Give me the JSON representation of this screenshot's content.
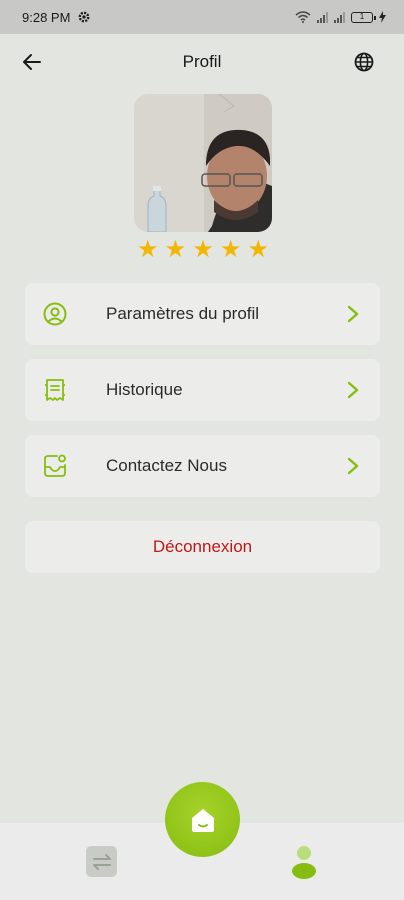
{
  "status_bar": {
    "time": "9:28 PM",
    "battery": "1"
  },
  "header": {
    "title": "Profil"
  },
  "profile": {
    "rating": 5,
    "stars": [
      "★",
      "★",
      "★",
      "★",
      "★"
    ]
  },
  "menu": {
    "items": [
      {
        "label": "Paramètres du profil",
        "icon": "user-circle-icon"
      },
      {
        "label": "Historique",
        "icon": "receipt-icon"
      },
      {
        "label": "Contactez Nous",
        "icon": "message-box-icon"
      }
    ]
  },
  "logout": {
    "label": "Déconnexion"
  },
  "colors": {
    "accent": "#86bd10",
    "star": "#f2b705",
    "danger": "#c01818",
    "background": "#e3e5e0"
  },
  "bottom_nav": {
    "items": [
      "swap-icon",
      "home-icon",
      "profile-icon"
    ],
    "active": "profile"
  }
}
